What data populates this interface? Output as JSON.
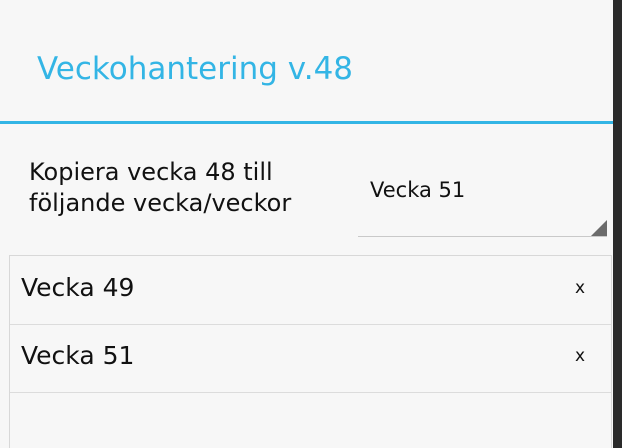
{
  "dialog": {
    "title": "Veckohantering v.48"
  },
  "copy_section": {
    "label_line1": "Kopiera vecka 48 till",
    "label_line2": "följande vecka/veckor",
    "spinner_selected": "Vecka 51"
  },
  "week_list": {
    "items": [
      {
        "label": "Vecka 49",
        "remove_label": "x"
      },
      {
        "label": "Vecka 51",
        "remove_label": "x"
      }
    ]
  },
  "colors": {
    "accent": "#33b5e5",
    "background": "#f7f7f7"
  }
}
